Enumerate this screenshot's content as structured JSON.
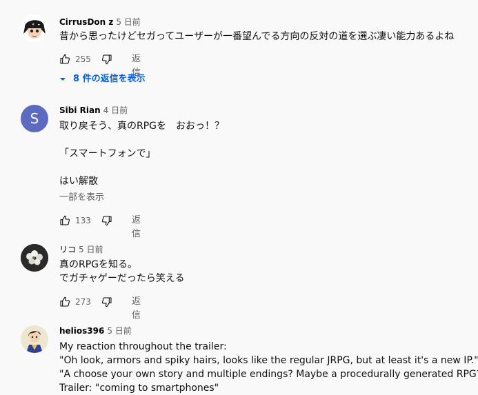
{
  "comments": [
    {
      "author": "CirrusDon z",
      "time": "5 日前",
      "lines": [
        "昔から思ったけどセガってユーザーが一番望んでる方向の反対の道を選ぶ凄い能力あるよね"
      ],
      "likes": "255",
      "reply_label": "返信",
      "replies_toggle": "8 件の返信を表示"
    },
    {
      "author": "Sibi Rian",
      "time": "4 日前",
      "avatar_letter": "S",
      "avatar_color": "#5c6bc0",
      "lines": [
        "取り戻そう、真のRPGを　おおっ！？",
        "",
        "「スマートフォンで」",
        "",
        "はい解散"
      ],
      "show_more": "一部を表示",
      "likes": "133",
      "reply_label": "返信"
    },
    {
      "author": "リコ",
      "time": "5 日前",
      "lines": [
        "真のRPGを知る。",
        "でガチャゲーだったら笑える"
      ],
      "likes": "273",
      "reply_label": "返信"
    },
    {
      "author": "helios396",
      "time": "5 日前",
      "lines": [
        "My reaction throughout the trailer:",
        "\"Oh look, armors and spiky hairs, looks like the regular JRPG, but at least it's a new IP.\"",
        "\"A choose your own story and multiple endings? Maybe a procedurally generated RPG?\"",
        "Trailer: \"coming to smartphones\""
      ]
    }
  ]
}
